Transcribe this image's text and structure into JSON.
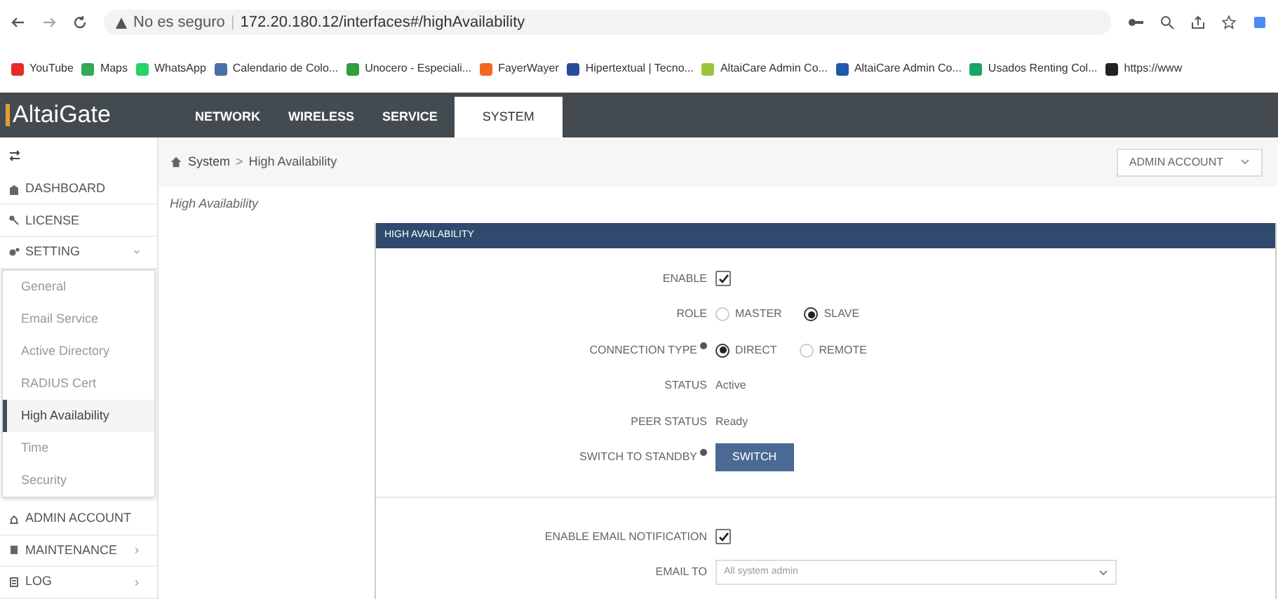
{
  "browser": {
    "security": "No es seguro",
    "separator": "|",
    "url": "172.20.180.12/interfaces#/highAvailability",
    "bookmarks": [
      {
        "label": "YouTube",
        "color": "#e52d27"
      },
      {
        "label": "Maps",
        "color": "#34a853"
      },
      {
        "label": "WhatsApp",
        "color": "#25d366"
      },
      {
        "label": "Calendario de Colo...",
        "color": "#4a6fa5"
      },
      {
        "label": "Unocero - Especiali...",
        "color": "#2e9e3e"
      },
      {
        "label": "FayerWayer",
        "color": "#f26522"
      },
      {
        "label": "Hipertextual | Tecno...",
        "color": "#2a4d9b"
      },
      {
        "label": "AltaiCare Admin Co...",
        "color": "#9bc53d"
      },
      {
        "label": "AltaiCare Admin Co...",
        "color": "#1e5aa8"
      },
      {
        "label": "Usados Renting Col...",
        "color": "#1aa36b"
      },
      {
        "label": "https://www",
        "color": "#222222"
      }
    ]
  },
  "app": {
    "logo": "AltaiGate",
    "nav": [
      {
        "label": "NETWORK",
        "selected": false
      },
      {
        "label": "WIRELESS",
        "selected": false
      },
      {
        "label": "SERVICE",
        "selected": false
      },
      {
        "label": "SYSTEM",
        "selected": true
      }
    ],
    "breadcrumb": [
      "System",
      "High Availability"
    ],
    "breadcrumb_separator": ">",
    "account": "ADMIN ACCOUNT",
    "page_title": "High Availability"
  },
  "sidebar": {
    "items": [
      {
        "label": "DASHBOARD",
        "kind": "link"
      },
      {
        "label": "LICENSE",
        "kind": "link"
      },
      {
        "label": "SETTING",
        "kind": "group",
        "expanded": true,
        "children": [
          {
            "label": "General",
            "selected": false
          },
          {
            "label": "Email Service",
            "selected": false
          },
          {
            "label": "Active Directory",
            "selected": false
          },
          {
            "label": "RADIUS Cert",
            "selected": false
          },
          {
            "label": "High Availability",
            "selected": true
          },
          {
            "label": "Time",
            "selected": false
          },
          {
            "label": "Security",
            "selected": false
          }
        ]
      },
      {
        "label": "ADMIN ACCOUNT",
        "kind": "link"
      },
      {
        "label": "MAINTENANCE",
        "kind": "group",
        "expanded": false
      },
      {
        "label": "LOG",
        "kind": "group",
        "expanded": false
      }
    ]
  },
  "panel": {
    "title": "HIGH AVAILABILITY",
    "rows": [
      {
        "kind": "checkbox",
        "label": "ENABLE",
        "checked": true
      },
      {
        "kind": "radio",
        "label": "ROLE",
        "options": [
          {
            "label": "MASTER",
            "selected": false
          },
          {
            "label": "SLAVE",
            "selected": true
          }
        ]
      },
      {
        "kind": "radio",
        "label": "CONNECTION TYPE",
        "info": true,
        "options": [
          {
            "label": "DIRECT",
            "selected": true
          },
          {
            "label": "REMOTE",
            "selected": false
          }
        ]
      },
      {
        "kind": "text",
        "label": "STATUS",
        "value": "Active"
      },
      {
        "kind": "text",
        "label": "PEER STATUS",
        "value": "Ready"
      },
      {
        "kind": "button",
        "label": "SWITCH TO STANDBY",
        "info": true,
        "value": "SWITCH"
      },
      {
        "kind": "divider"
      },
      {
        "kind": "checkbox",
        "label": "ENABLE EMAIL NOTIFICATION",
        "checked": true
      },
      {
        "kind": "select",
        "label": "EMAIL TO",
        "value": "All system admin"
      }
    ]
  }
}
